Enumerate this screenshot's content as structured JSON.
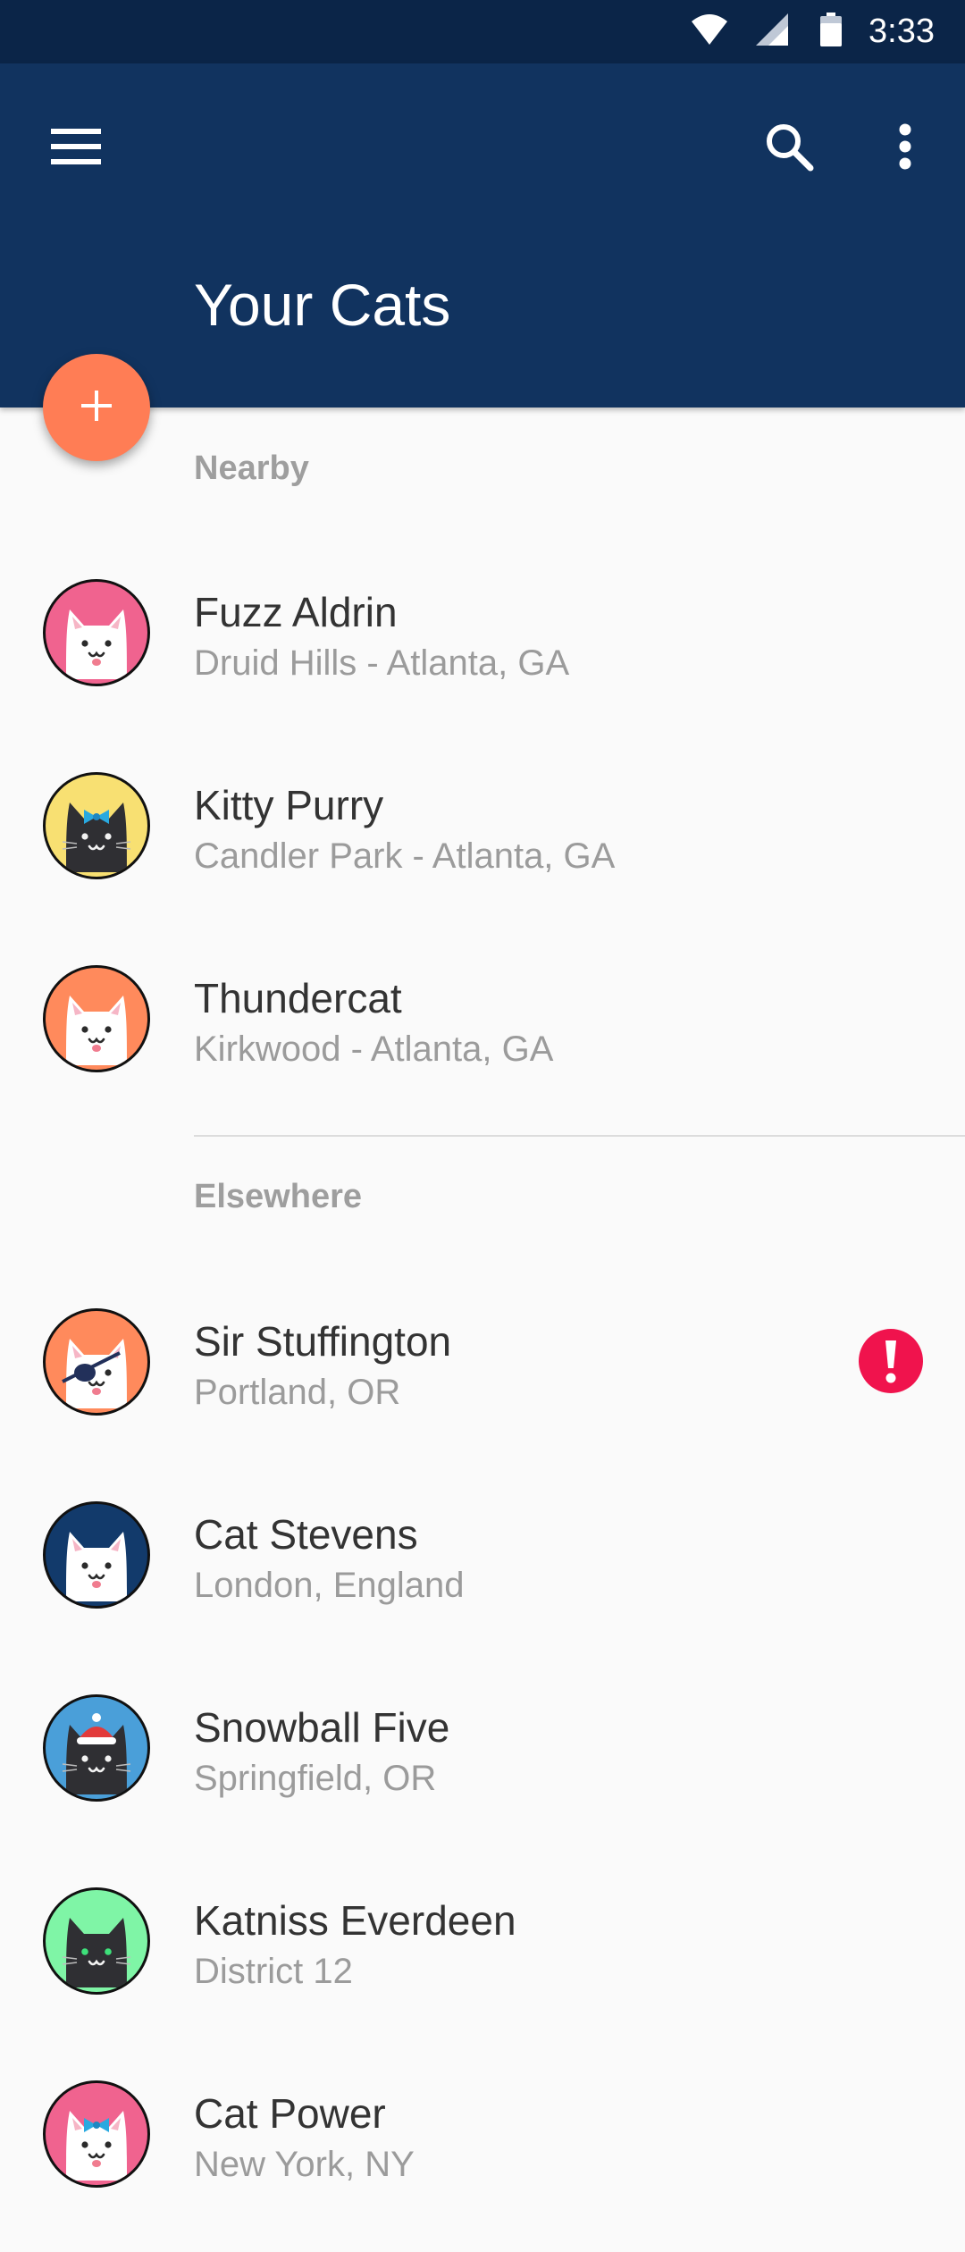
{
  "status_bar": {
    "time": "3:33"
  },
  "app_bar": {
    "title": "Your Cats",
    "icons": [
      "menu-icon",
      "search-icon",
      "more-vert-icon"
    ]
  },
  "fab": {
    "icon": "plus-icon",
    "color": "#ff7d55"
  },
  "colors": {
    "app_bar": "#11335f",
    "status_bar": "#0b2548",
    "alert": "#f0134d"
  },
  "nearby": {
    "header": "Nearby",
    "items": [
      {
        "name": "Fuzz Aldrin",
        "location": "Druid Hills - Atlanta, GA",
        "avatar": "white-cat-pink-bg-icon"
      },
      {
        "name": "Kitty Purry",
        "location": "Candler Park - Atlanta, GA",
        "avatar": "black-cat-bow-yellow-bg-icon"
      },
      {
        "name": "Thundercat",
        "location": "Kirkwood - Atlanta, GA",
        "avatar": "white-cat-orange-bg-icon"
      }
    ]
  },
  "elsewhere": {
    "header": "Elsewhere",
    "items": [
      {
        "name": "Sir Stuffington",
        "location": "Portland, OR",
        "avatar": "white-cat-eyepatch-orange-bg-icon",
        "alert": true
      },
      {
        "name": "Cat Stevens",
        "location": "London, England",
        "avatar": "white-cat-navy-bg-icon"
      },
      {
        "name": "Snowball Five",
        "location": "Springfield, OR",
        "avatar": "black-cat-santa-hat-blue-bg-icon"
      },
      {
        "name": "Katniss Everdeen",
        "location": "District 12",
        "avatar": "black-cat-green-bg-icon"
      },
      {
        "name": "Cat Power",
        "location": "New York, NY",
        "avatar": "white-cat-bow-pink-bg-icon"
      }
    ]
  }
}
